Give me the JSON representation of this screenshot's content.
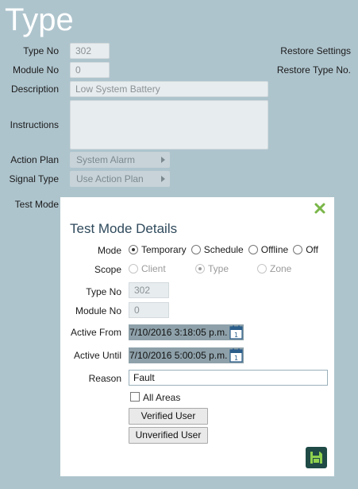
{
  "page": {
    "title": "Type"
  },
  "form": {
    "type_no_label": "Type No",
    "type_no_value": "302",
    "module_no_label": "Module No",
    "module_no_value": "0",
    "description_label": "Description",
    "description_value": "Low System Battery",
    "instructions_label": "Instructions",
    "instructions_value": "",
    "action_plan_label": "Action Plan",
    "action_plan_value": "System Alarm",
    "signal_type_label": "Signal Type",
    "signal_type_value": "Use Action Plan",
    "test_mode_label": "Test Mode"
  },
  "links": {
    "restore_settings": "Restore Settings",
    "restore_type_no": "Restore Type No."
  },
  "modal": {
    "title": "Test Mode Details",
    "mode_label": "Mode",
    "mode_options": [
      "Temporary",
      "Schedule",
      "Offline",
      "Off"
    ],
    "mode_selected": "Temporary",
    "scope_label": "Scope",
    "scope_options": [
      "Client",
      "Type",
      "Zone"
    ],
    "scope_selected": "Type",
    "type_no_label": "Type No",
    "type_no_value": "302",
    "module_no_label": "Module No",
    "module_no_value": "0",
    "active_from_label": "Active From",
    "active_from_value": "7/10/2016 3:18:05 p.m.",
    "active_until_label": "Active Until",
    "active_until_value": "7/10/2016 5:00:05 p.m.",
    "reason_label": "Reason",
    "reason_value": "Fault",
    "all_areas_label": "All Areas",
    "verified_user_label": "Verified User",
    "unverified_user_label": "Unverified User"
  },
  "colors": {
    "background": "#aec4cd",
    "title": "#ffffff",
    "modal_title": "#2f4a5c",
    "close_icon": "#7ab648",
    "save_button": "#1f4a46",
    "save_icon": "#8fd14f"
  },
  "icons": {
    "close": "close-icon",
    "calendar": "calendar-icon",
    "save": "floppy-disk-icon"
  }
}
